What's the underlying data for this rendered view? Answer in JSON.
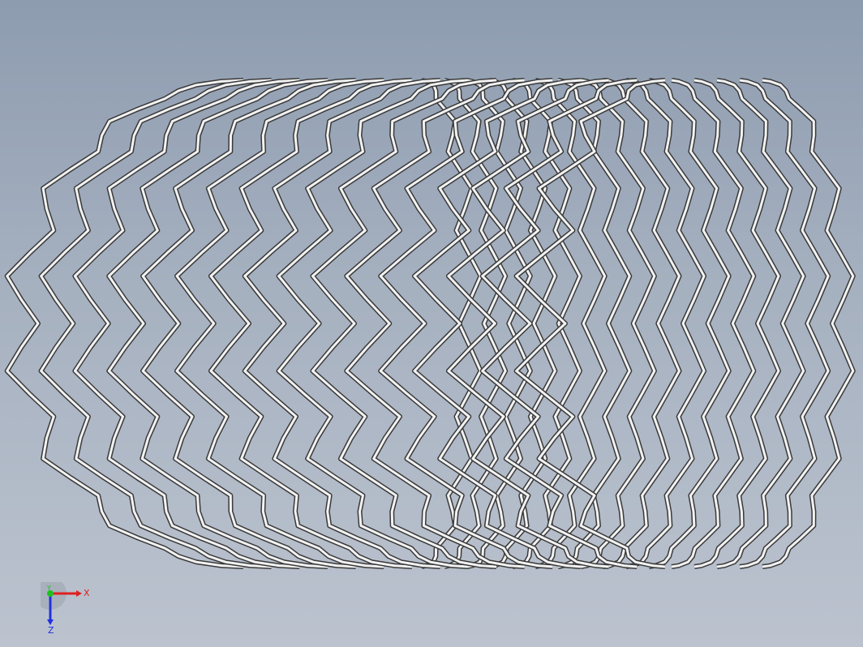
{
  "viewport": {
    "background_top": "#8e9cb0",
    "background_bottom": "#bcc3cf"
  },
  "model": {
    "name": "stent-wire-mesh",
    "ring_count": 16,
    "zigzag_peaks_per_ring": 8,
    "wire_color_light": "#f2f2f2",
    "wire_color_dark": "#3a3a3a"
  },
  "triad": {
    "x_label": "X",
    "y_label": "Y",
    "z_label": "Z",
    "x_color": "#e02020",
    "y_color": "#20c020",
    "z_color": "#2030e0"
  }
}
